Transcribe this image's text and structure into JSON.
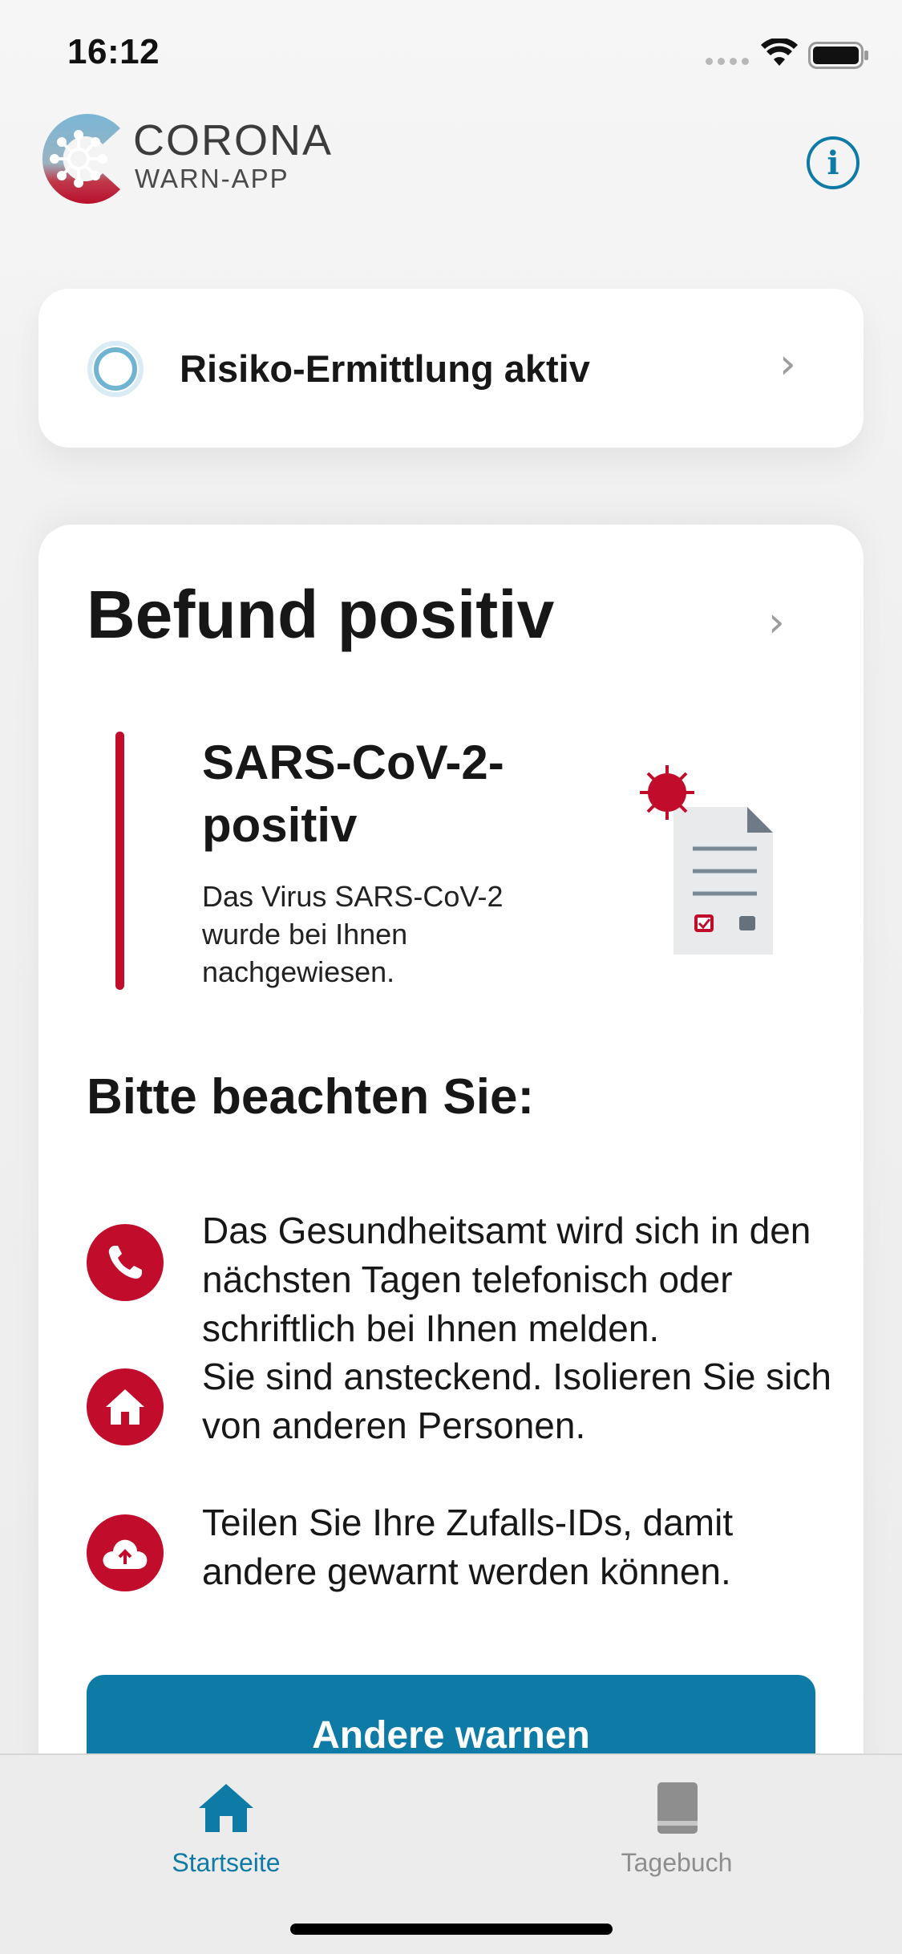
{
  "status_bar": {
    "time": "16:12",
    "icons": [
      "signal-dots-icon",
      "wifi-icon",
      "battery-icon"
    ]
  },
  "header": {
    "logo_title": "CORONA",
    "logo_subtitle": "WARN-APP",
    "info_icon": "info-icon"
  },
  "risk_card": {
    "label": "Risiko-Ermittlung aktiv",
    "icon": "risk-ring-icon",
    "chevron_icon": "chevron-right-icon"
  },
  "result_card": {
    "title": "Befund positiv",
    "test_title": "SARS-CoV-2-positiv",
    "test_description": "Das Virus SARS-CoV-2 wurde bei Ihnen nachgewiesen.",
    "notice_heading": "Bitte beachten Sie:",
    "notices": [
      {
        "icon": "phone-icon",
        "text": "Das Gesundheitsamt wird sich in den nächsten Tagen telefonisch oder schriftlich bei Ihnen melden."
      },
      {
        "icon": "home-icon",
        "text": "Sie sind ansteckend. Isolieren Sie sich von anderen Personen."
      },
      {
        "icon": "cloud-upload-icon",
        "text": "Teilen Sie Ihre Zufalls-IDs, damit andere gewarnt werden können."
      }
    ],
    "primary_button": "Andere warnen"
  },
  "tab_bar": {
    "tabs": [
      {
        "label": "Startseite",
        "icon": "home-icon",
        "active": true
      },
      {
        "label": "Tagebuch",
        "icon": "book-icon",
        "active": false
      }
    ]
  },
  "colors": {
    "accent_blue": "#0e7ba6",
    "alert_red": "#c10c2c",
    "inactive_gray": "#8e8e8e"
  }
}
